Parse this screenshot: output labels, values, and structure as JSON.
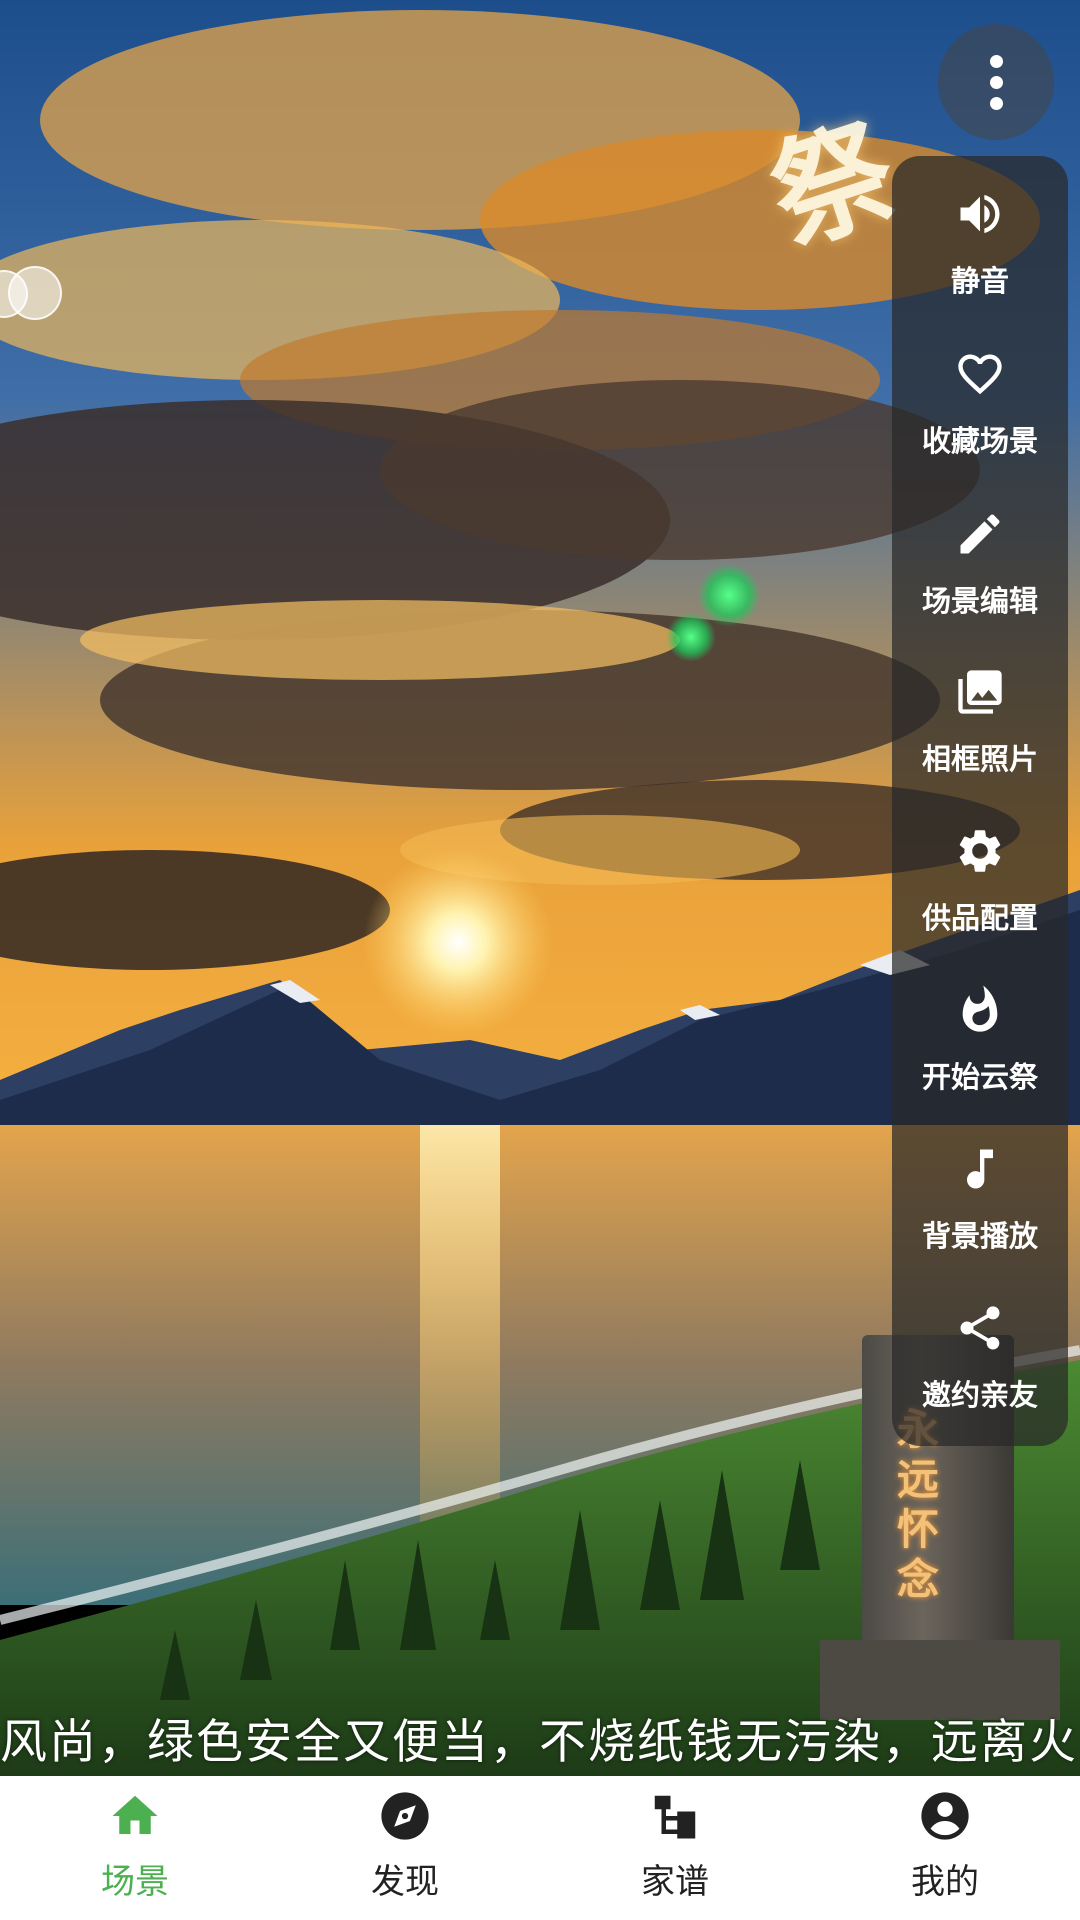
{
  "scene": {
    "calligraphy": "祭",
    "monument_text": "永远怀念"
  },
  "side_menu": {
    "items": [
      {
        "label": "静音",
        "icon": "volume-icon"
      },
      {
        "label": "收藏场景",
        "icon": "heart-icon"
      },
      {
        "label": "场景编辑",
        "icon": "pencil-icon"
      },
      {
        "label": "相框照片",
        "icon": "photo-icon"
      },
      {
        "label": "供品配置",
        "icon": "gear-icon"
      },
      {
        "label": "开始云祭",
        "icon": "flame-icon"
      },
      {
        "label": "背景播放",
        "icon": "music-note-icon"
      },
      {
        "label": "邀约亲友",
        "icon": "share-icon"
      }
    ]
  },
  "marquee": {
    "text": "风尚，绿色安全又便当，不烧纸钱无污染，远离火"
  },
  "bottom_nav": {
    "items": [
      {
        "label": "场景",
        "icon": "home-icon",
        "active": true
      },
      {
        "label": "发现",
        "icon": "compass-icon",
        "active": false
      },
      {
        "label": "家谱",
        "icon": "family-tree-icon",
        "active": false
      },
      {
        "label": "我的",
        "icon": "account-icon",
        "active": false
      }
    ],
    "active_color": "#4caf50",
    "inactive_color": "#222222"
  }
}
